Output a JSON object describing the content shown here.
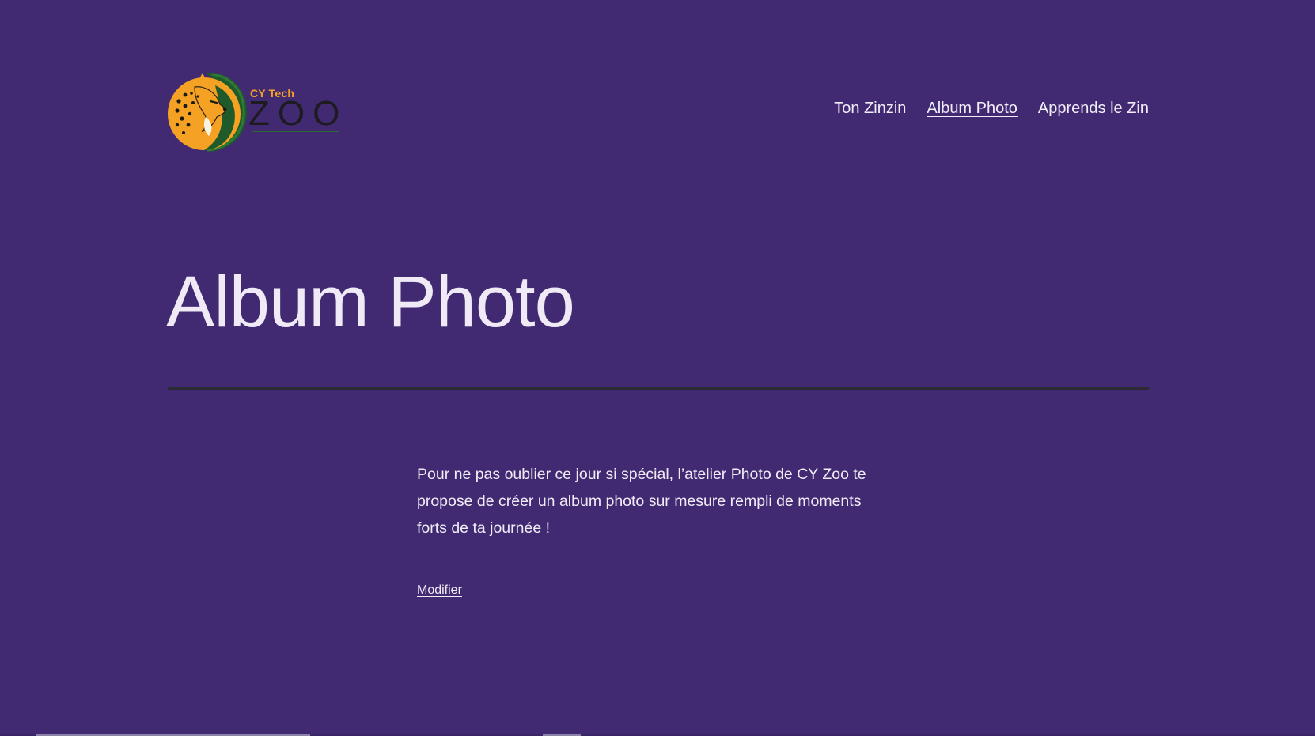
{
  "logo": {
    "small_text": "CY Tech",
    "big_text": "ZOO",
    "icon": "cheetah-icon"
  },
  "nav": {
    "items": [
      {
        "label": "Ton Zinzin",
        "current": false
      },
      {
        "label": "Album Photo",
        "current": true
      },
      {
        "label": "Apprends le Zin",
        "current": false
      }
    ]
  },
  "page": {
    "title": "Album Photo",
    "body": "Pour ne pas oublier ce jour si spécial, l’atelier Photo de CY Zoo te propose de créer un album photo sur mesure rempli de moments forts de ta journée !",
    "edit_label": "Modifier"
  },
  "colors": {
    "background": "#412a72",
    "logo_orange": "#f5a224",
    "logo_green": "#1f5a2a",
    "divider": "#2c2a35"
  }
}
